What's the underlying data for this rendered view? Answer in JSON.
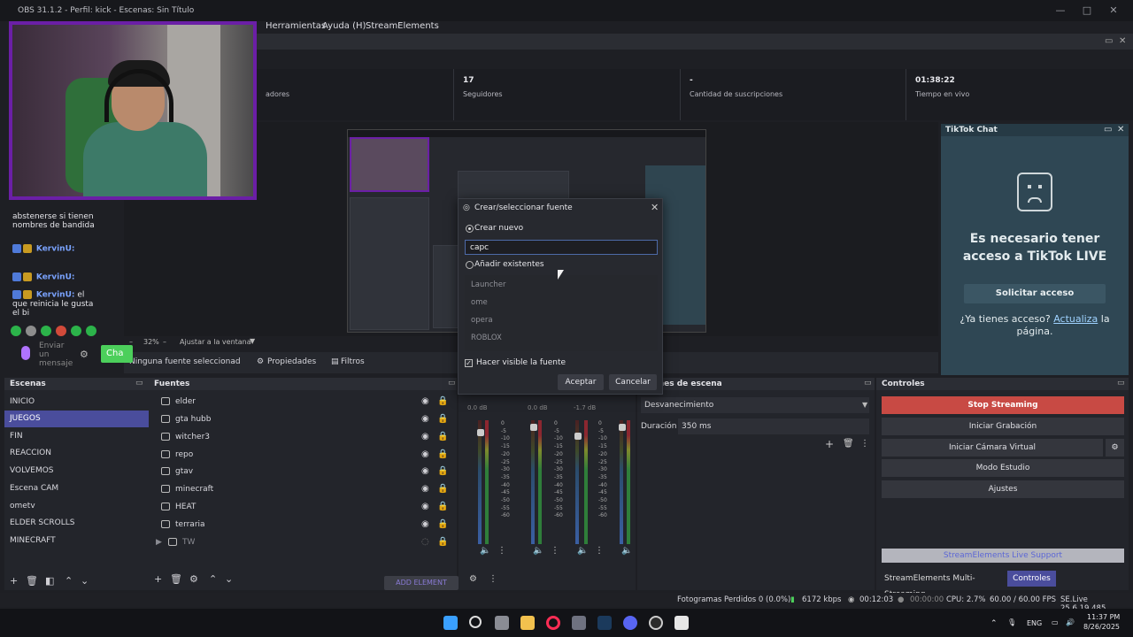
{
  "window": {
    "title": "OBS 31.1.2 - Perfil: kick - Escenas: Sin Título"
  },
  "menu": [
    "Herramientas",
    "Ayuda (H)",
    "StreamElements"
  ],
  "stats": [
    {
      "value": "",
      "label": "adores"
    },
    {
      "value": "17",
      "label": "Seguidores"
    },
    {
      "value": "-",
      "label": "Cantidad de suscripciones"
    },
    {
      "value": "01:38:22",
      "label": "Tiempo en vivo"
    }
  ],
  "chat": {
    "lines": [
      {
        "user": "",
        "text": "abstenerse si tienen nombres de bandida"
      },
      {
        "user": "KervinU:",
        "text": ""
      },
      {
        "user": "KervinU:",
        "text": ""
      },
      {
        "user": "KervinU:",
        "text": "el que reinicia le gusta el bi"
      }
    ],
    "send_placeholder": "Enviar un mensaje",
    "chat_button": "Cha"
  },
  "preview": {
    "zoom": "32%",
    "fit_label": "Ajustar a la ventana"
  },
  "source_bar": {
    "no_source": "Ninguna fuente seleccionad",
    "properties": "Propiedades",
    "filters": "Filtros"
  },
  "tiktok": {
    "title": "TikTok Chat",
    "message": "Es necesario tener acceso a TikTok LIVE",
    "request_button": "Solicitar acceso",
    "note_prefix": "¿Ya tienes acceso?",
    "note_link": "Actualiza",
    "note_suffix": "la página."
  },
  "scenes": {
    "title": "Escenas",
    "items": [
      "INICIO",
      "JUEGOS",
      "FIN",
      "REACCION",
      "VOLVEMOS",
      "Escena CAM",
      "ometv",
      "ELDER SCROLLS",
      "MINECRAFT"
    ],
    "selected": "JUEGOS"
  },
  "sources": {
    "title": "Fuentes",
    "items": [
      "elder",
      "gta hubb",
      "witcher3",
      "repo",
      "gtav",
      "minecraft",
      "HEAT",
      "terraria"
    ],
    "group": "TW",
    "add_element": "ADD ELEMENT"
  },
  "mixer": {
    "channels": [
      {
        "name": "",
        "db": "0.0 dB"
      },
      {
        "name": "",
        "db": "0.0 dB"
      },
      {
        "name": "",
        "db": "-1.7 dB"
      },
      {
        "name": "",
        "db": ""
      }
    ],
    "scale": [
      "0",
      "-5",
      "-10",
      "-15",
      "-20",
      "-25",
      "-30",
      "-35",
      "-40",
      "-45",
      "-50",
      "-55",
      "-60"
    ]
  },
  "transitions": {
    "title": "iciones de escena",
    "selected": "Desvanecimiento",
    "duration_label": "Duración",
    "duration_value": "350 ms"
  },
  "controls": {
    "title": "Controles",
    "buttons": [
      "Stop Streaming",
      "Iniciar Grabación",
      "Iniciar Cámara Virtual",
      "Modo Estudio",
      "Ajustes"
    ],
    "se_support": "StreamElements Live Support",
    "tab_multi": "StreamElements Multi-Streaming",
    "tab_controls": "Controles"
  },
  "dialog": {
    "title": "Crear/seleccionar fuente",
    "create_new": "Crear nuevo",
    "input_value": "capc",
    "add_existing": "Añadir existentes",
    "existing": [
      "Launcher",
      "ome",
      "opera",
      "ROBLOX"
    ],
    "visible_label": "Hacer visible la fuente",
    "ok": "Aceptar",
    "cancel": "Cancelar"
  },
  "status": {
    "dropped": "Fotogramas Perdidos 0 (0.0%)",
    "kbps": "6172 kbps",
    "stream_time": "00:12:03",
    "rec_time": "00:00:00",
    "cpu": "CPU: 2.7%",
    "fps": "60.00 / 60.00 FPS",
    "version": "SE.Live 25.6.19.485"
  },
  "taskbar": {
    "lang": "ENG",
    "time": "11:37 PM",
    "date": "8/26/2025"
  },
  "colors": {
    "accent": "#4a4d9c",
    "stop": "#c84a44",
    "webcam_border": "#6b1fa6",
    "tiktok_bg": "#2f4754"
  }
}
